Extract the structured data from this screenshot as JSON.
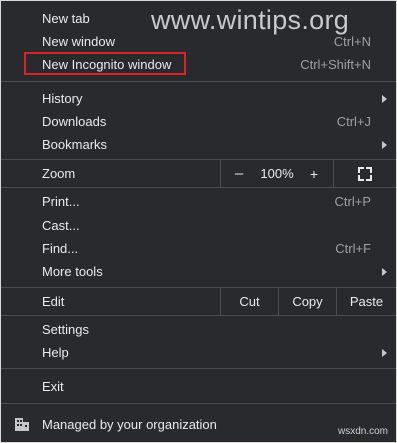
{
  "watermark": "www.wintips.org",
  "menu": {
    "new_tab": {
      "label": "New tab",
      "shortcut": "Ctrl+T"
    },
    "new_window": {
      "label": "New window",
      "shortcut": "Ctrl+N"
    },
    "new_incognito": {
      "label": "New Incognito window",
      "shortcut": "Ctrl+Shift+N"
    },
    "history": {
      "label": "History"
    },
    "downloads": {
      "label": "Downloads",
      "shortcut": "Ctrl+J"
    },
    "bookmarks": {
      "label": "Bookmarks"
    },
    "zoom": {
      "label": "Zoom",
      "minus": "–",
      "level": "100%",
      "plus": "+"
    },
    "print": {
      "label": "Print...",
      "shortcut": "Ctrl+P"
    },
    "cast": {
      "label": "Cast..."
    },
    "find": {
      "label": "Find...",
      "shortcut": "Ctrl+F"
    },
    "more_tools": {
      "label": "More tools"
    },
    "edit": {
      "label": "Edit",
      "cut": "Cut",
      "copy": "Copy",
      "paste": "Paste"
    },
    "settings": {
      "label": "Settings"
    },
    "help": {
      "label": "Help"
    },
    "exit": {
      "label": "Exit"
    },
    "managed": {
      "label": "Managed by your organization",
      "icon": "building-icon"
    }
  },
  "footer_watermark": "wsxdn.com",
  "colors": {
    "menu_bg": "#292a2d",
    "text": "#e8eaed",
    "shortcut": "#9aa0a6",
    "separator": "#4a4c50",
    "highlight_border": "#d9232b"
  }
}
